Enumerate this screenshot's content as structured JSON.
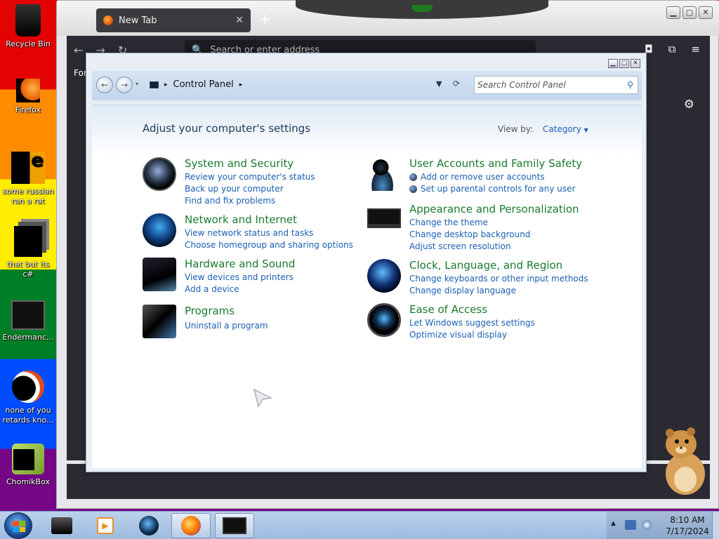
{
  "desktop": {
    "icons": [
      {
        "label": "Recycle Bin"
      },
      {
        "label": "Firefox"
      },
      {
        "label": "some russian ran a rat"
      },
      {
        "label": "that but its c#"
      },
      {
        "label": "Endermanc..."
      },
      {
        "label": "none of you retards kno..."
      },
      {
        "label": "ChomikBox"
      }
    ]
  },
  "browser": {
    "tab_title": "New Tab",
    "tab_close": "✕",
    "new_tab": "+",
    "window_buttons": {
      "minimize": "▁",
      "maximize": "▢",
      "close": "✕"
    },
    "nav": {
      "back": "←",
      "forward": "→",
      "reload": "↻"
    },
    "address_placeholder": "Search or enter address",
    "body_partial_text": "For",
    "settings_icon": "⚙"
  },
  "control_panel": {
    "window_buttons": {
      "minimize": "▁",
      "maximize": "▢",
      "close": "✕"
    },
    "back": "←",
    "forward": "→",
    "path": "Control Panel",
    "path_separator": "▸",
    "search_placeholder": "Search Control Panel",
    "heading": "Adjust your computer's settings",
    "view_by_label": "View by:",
    "view_by_value": "Category",
    "categories": [
      {
        "title": "System and Security",
        "links": [
          "Review your computer's status",
          "Back up your computer",
          "Find and fix problems"
        ],
        "icon": "shield-icon"
      },
      {
        "title": "Network and Internet",
        "links": [
          "View network status and tasks",
          "Choose homegroup and sharing options"
        ],
        "icon": "network-globe-icon"
      },
      {
        "title": "Hardware and Sound",
        "links": [
          "View devices and printers",
          "Add a device"
        ],
        "icon": "printer-speaker-icon"
      },
      {
        "title": "Programs",
        "links": [
          "Uninstall a program"
        ],
        "icon": "programs-icon"
      },
      {
        "title": "User Accounts and Family Safety",
        "links": [
          "Add or remove user accounts",
          "Set up parental controls for any user"
        ],
        "icon": "users-icon"
      },
      {
        "title": "Appearance and Personalization",
        "links": [
          "Change the theme",
          "Change desktop background",
          "Adjust screen resolution"
        ],
        "icon": "monitor-icon"
      },
      {
        "title": "Clock, Language, and Region",
        "links": [
          "Change keyboards or other input methods",
          "Change display language"
        ],
        "icon": "clock-globe-icon"
      },
      {
        "title": "Ease of Access",
        "links": [
          "Let Windows suggest settings",
          "Optimize visual display"
        ],
        "icon": "ease-of-access-icon"
      }
    ]
  },
  "taskbar": {
    "apps": [
      {
        "name": "file-manager"
      },
      {
        "name": "media-player"
      },
      {
        "name": "control-panel-globe"
      },
      {
        "name": "firefox"
      },
      {
        "name": "control-panel-window"
      }
    ],
    "time": "8:10 AM",
    "date": "7/17/2024"
  }
}
